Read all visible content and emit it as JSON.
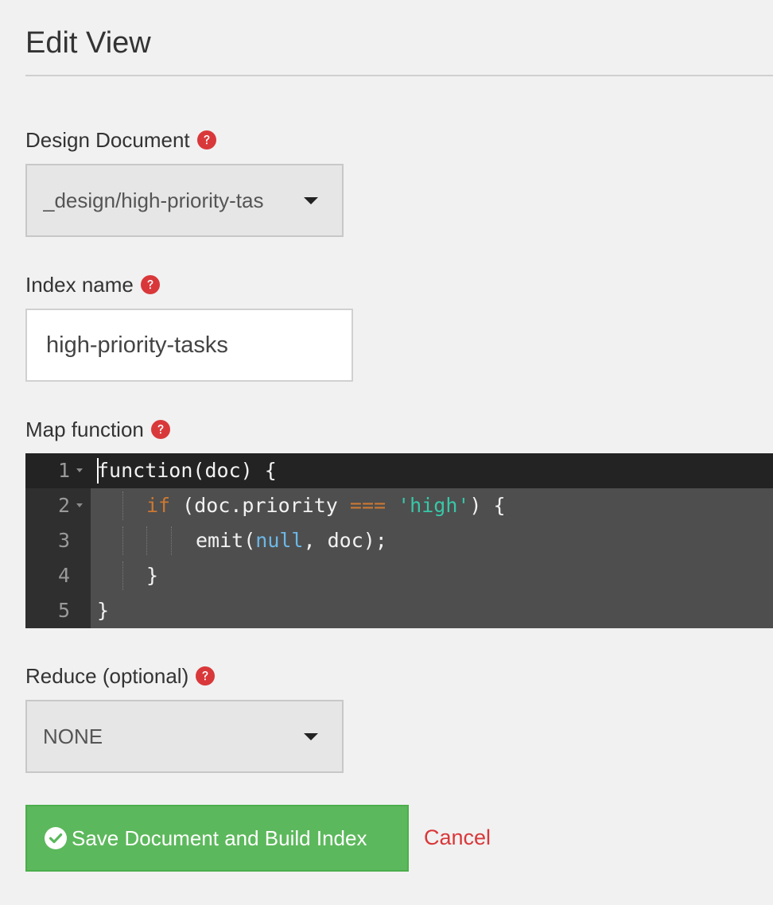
{
  "page": {
    "title": "Edit View"
  },
  "design_document": {
    "label": "Design Document",
    "selected": "_design/high-priority-tas"
  },
  "index_name": {
    "label": "Index name",
    "value": "high-priority-tasks"
  },
  "map_function": {
    "label": "Map function",
    "lines": [
      {
        "number": "1",
        "tokens": [
          "function(doc) {"
        ]
      },
      {
        "number": "2",
        "tokens": [
          "if",
          " (doc.priority ",
          "===",
          " ",
          "'high'",
          ") {"
        ]
      },
      {
        "number": "3",
        "tokens": [
          "emit(",
          "null",
          ", doc);"
        ]
      },
      {
        "number": "4",
        "tokens": [
          "}"
        ]
      },
      {
        "number": "5",
        "tokens": [
          "}"
        ]
      }
    ]
  },
  "reduce": {
    "label": "Reduce (optional)",
    "selected": "NONE"
  },
  "actions": {
    "save_label": "Save Document and Build Index",
    "cancel_label": "Cancel"
  },
  "colors": {
    "primary_button": "#5cb85c",
    "cancel_link": "#d9383a",
    "help_icon": "#d9383a",
    "editor_background": "#4e4e4e",
    "keyword": "#cc7832",
    "string": "#38c7a8",
    "constant": "#6cb8e6"
  },
  "icons": {
    "help": "question-circle-icon",
    "caret": "caret-down-icon",
    "save": "check-circle-icon",
    "fold": "fold-arrow-icon"
  }
}
